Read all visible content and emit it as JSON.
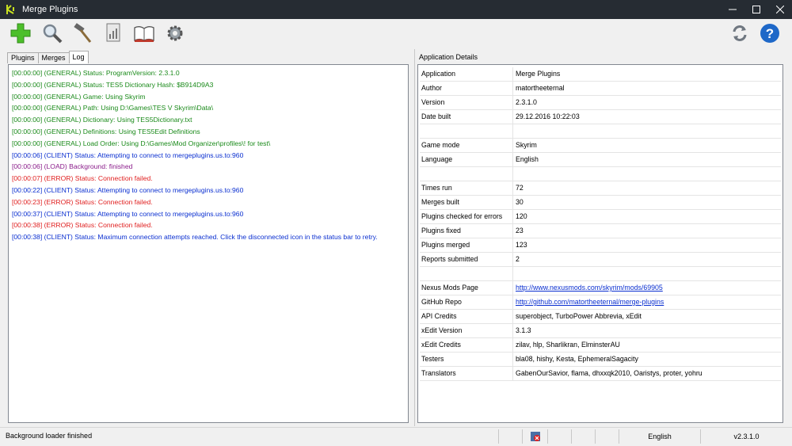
{
  "window": {
    "title": "Merge Plugins",
    "controls": [
      "minimize-icon",
      "maximize-icon",
      "close-icon"
    ]
  },
  "toolbar": {
    "icons": [
      "add-plus-icon",
      "magnifier-icon",
      "hammer-icon",
      "report-icon",
      "book-icon",
      "gear-icon",
      "refresh-icon",
      "help-icon"
    ]
  },
  "tabs": [
    {
      "label": "Plugins"
    },
    {
      "label": "Merges"
    },
    {
      "label": "Log"
    }
  ],
  "log": [
    {
      "text": "[00:00:00] (GENERAL) Status: ProgramVersion: 2.3.1.0",
      "type": "general"
    },
    {
      "text": "[00:00:00] (GENERAL) Status: TES5 Dictionary Hash: $B914D9A3",
      "type": "general"
    },
    {
      "text": "[00:00:00] (GENERAL) Game: Using Skyrim",
      "type": "general"
    },
    {
      "text": "[00:00:00] (GENERAL) Path: Using D:\\Games\\TES V Skyrim\\Data\\",
      "type": "general"
    },
    {
      "text": "[00:00:00] (GENERAL) Dictionary: Using TES5Dictionary.txt",
      "type": "general"
    },
    {
      "text": "[00:00:00] (GENERAL) Definitions: Using TES5Edit Definitions",
      "type": "general"
    },
    {
      "text": "[00:00:00] (GENERAL) Load Order: Using D:\\Games\\Mod Organizer\\profiles\\! for test\\",
      "type": "general"
    },
    {
      "text": "[00:00:06] (CLIENT) Status: Attempting to connect to mergeplugins.us.to:960",
      "type": "client"
    },
    {
      "text": "[00:00:06] (LOAD) Background: finished",
      "type": "load"
    },
    {
      "text": "[00:00:07] (ERROR) Status: Connection failed.",
      "type": "error"
    },
    {
      "text": "[00:00:22] (CLIENT) Status: Attempting to connect to mergeplugins.us.to:960",
      "type": "client"
    },
    {
      "text": "[00:00:23] (ERROR) Status: Connection failed.",
      "type": "error"
    },
    {
      "text": "[00:00:37] (CLIENT) Status: Attempting to connect to mergeplugins.us.to:960",
      "type": "client"
    },
    {
      "text": "[00:00:38] (ERROR) Status: Connection failed.",
      "type": "error"
    },
    {
      "text": "[00:00:38] (CLIENT) Status: Maximum connection attempts reached.  Click the disconnected icon in the status bar to retry.",
      "type": "client"
    }
  ],
  "details": {
    "header": "Application Details",
    "rows": [
      {
        "key": "Application",
        "value": "Merge Plugins",
        "link": false
      },
      {
        "key": "Author",
        "value": "matortheeternal",
        "link": false
      },
      {
        "key": "Version",
        "value": "2.3.1.0",
        "link": false
      },
      {
        "key": "Date built",
        "value": "29.12.2016 10:22:03",
        "link": false
      },
      {
        "key": "",
        "value": "",
        "link": false
      },
      {
        "key": "Game mode",
        "value": "Skyrim",
        "link": false
      },
      {
        "key": "Language",
        "value": "English",
        "link": false
      },
      {
        "key": "",
        "value": "",
        "link": false
      },
      {
        "key": "Times run",
        "value": "72",
        "link": false
      },
      {
        "key": "Merges built",
        "value": "30",
        "link": false
      },
      {
        "key": "Plugins checked for errors",
        "value": "120",
        "link": false
      },
      {
        "key": "Plugins fixed",
        "value": "23",
        "link": false
      },
      {
        "key": "Plugins merged",
        "value": "123",
        "link": false
      },
      {
        "key": "Reports submitted",
        "value": "2",
        "link": false
      },
      {
        "key": "",
        "value": "",
        "link": false
      },
      {
        "key": "Nexus Mods Page",
        "value": "http://www.nexusmods.com/skyrim/mods/69905",
        "link": true
      },
      {
        "key": "GitHub Repo",
        "value": "http://github.com/matortheeternal/merge-plugins",
        "link": true
      },
      {
        "key": "API Credits",
        "value": "superobject, TurboPower Abbrevia, xEdit",
        "link": false
      },
      {
        "key": "xEdit Version",
        "value": "3.1.3",
        "link": false
      },
      {
        "key": "xEdit Credits",
        "value": "zilav, hlp, Sharlikran, ElminsterAU",
        "link": false
      },
      {
        "key": "Testers",
        "value": "bla08, hishy, Kesta, EphemeralSagacity",
        "link": false
      },
      {
        "key": "Translators",
        "value": "GabenOurSavior, flama, dhxxqk2010, Oaristys, proter, yohru",
        "link": false
      }
    ]
  },
  "statusbar": {
    "message": "Background loader finished",
    "language": "English",
    "version": "v2.3.1.0",
    "connection_icon": "disconnected-icon"
  }
}
